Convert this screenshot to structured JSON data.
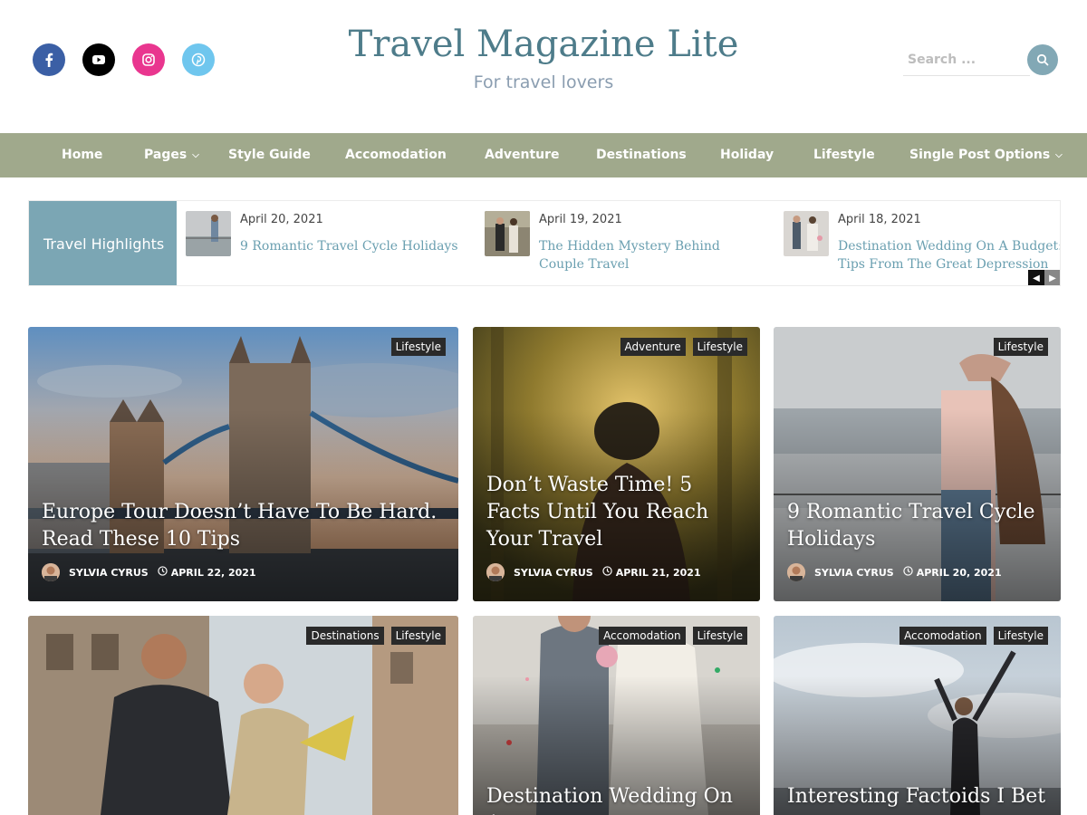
{
  "header": {
    "title": "Travel Magazine Lite",
    "tagline": "For travel lovers",
    "search_placeholder": "Search ...",
    "socials": [
      {
        "icon": "facebook-icon",
        "color": "#3b5fa5"
      },
      {
        "icon": "youtube-icon",
        "color": "#000000"
      },
      {
        "icon": "instagram-icon",
        "color": "#e9368f"
      },
      {
        "icon": "pinterest-icon",
        "color": "#6fc6ee"
      }
    ]
  },
  "nav": {
    "items": [
      {
        "label": "Home"
      },
      {
        "label": "Pages"
      },
      {
        "label": "Style Guide"
      },
      {
        "label": "Accomodation"
      },
      {
        "label": "Adventure"
      },
      {
        "label": "Destinations"
      },
      {
        "label": "Holiday"
      },
      {
        "label": "Lifestyle"
      },
      {
        "label": "Single Post Options"
      }
    ]
  },
  "highlights": {
    "label": "Travel Highlights",
    "items": [
      {
        "date": "April 20, 2021",
        "title": "9 Romantic Travel Cycle Holidays"
      },
      {
        "date": "April 19, 2021",
        "title": "The Hidden Mystery Behind Couple Travel"
      },
      {
        "date": "April 18, 2021",
        "title": "Destination Wedding On A Budget: Tips From The Great Depression"
      }
    ]
  },
  "cards": [
    {
      "tags": [
        "Lifestyle"
      ],
      "title": "Europe Tour Doesn’t Have To Be Hard. Read These 10 Tips",
      "author": "SYLVIA CYRUS",
      "date": "APRIL 22, 2021"
    },
    {
      "tags": [
        "Adventure",
        "Lifestyle"
      ],
      "title": "Don’t Waste Time! 5 Facts Until You Reach Your Travel",
      "author": "SYLVIA CYRUS",
      "date": "APRIL 21, 2021"
    },
    {
      "tags": [
        "Lifestyle"
      ],
      "title": "9 Romantic Travel Cycle Holidays",
      "author": "SYLVIA CYRUS",
      "date": "APRIL 20, 2021"
    },
    {
      "tags": [
        "Destinations",
        "Lifestyle"
      ],
      "title": "",
      "author": "",
      "date": ""
    },
    {
      "tags": [
        "Accomodation",
        "Lifestyle"
      ],
      "title": "Destination Wedding On A",
      "author": "",
      "date": ""
    },
    {
      "tags": [
        "Accomodation",
        "Lifestyle"
      ],
      "title": "Interesting Factoids I Bet",
      "author": "",
      "date": ""
    }
  ],
  "colors": {
    "accent": "#7ba6b4",
    "nav_bg": "#a0a98c",
    "title": "#4e7c8a"
  }
}
